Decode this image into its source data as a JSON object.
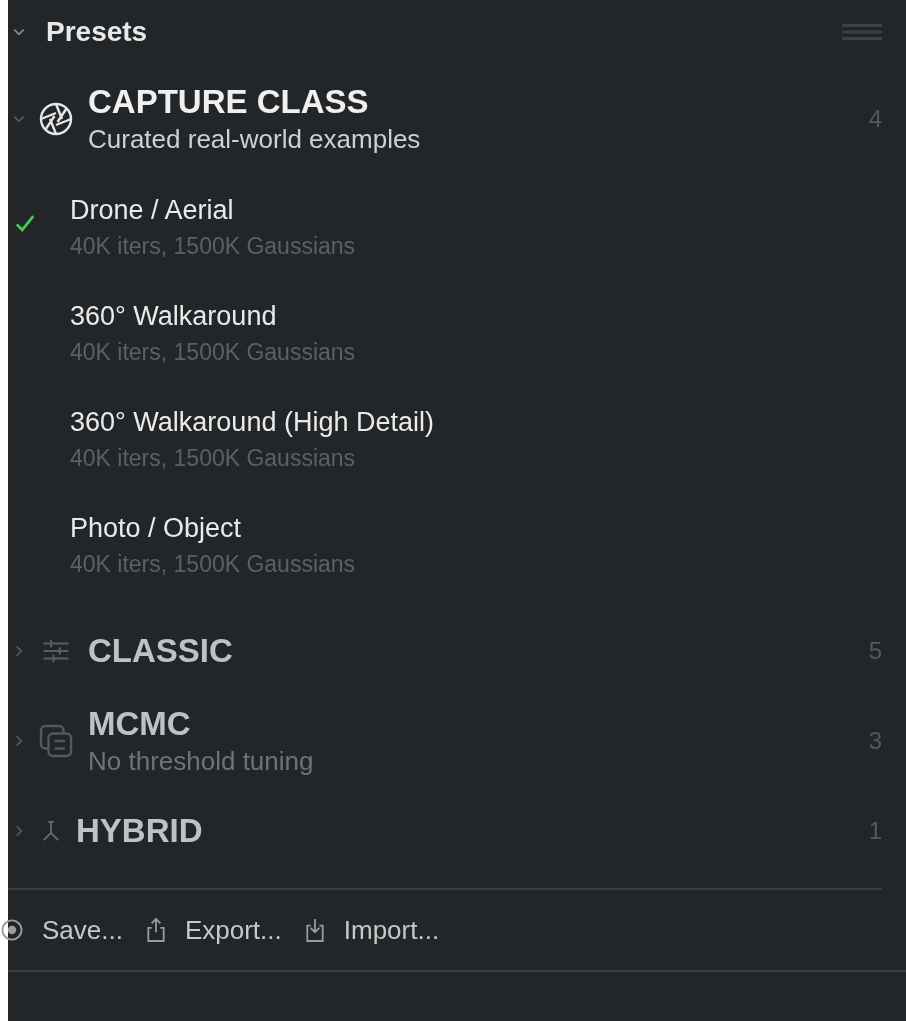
{
  "panel": {
    "title": "Presets",
    "expanded": true
  },
  "groups": [
    {
      "title": "CAPTURE CLASS",
      "subtitle": "Curated real-world examples",
      "count": "4",
      "expanded": true,
      "presets": [
        {
          "name": "Drone / Aerial",
          "detail": "40K iters, 1500K Gaussians",
          "selected": true
        },
        {
          "name": "360° Walkaround",
          "detail": "40K iters, 1500K Gaussians",
          "selected": false
        },
        {
          "name": "360° Walkaround (High Detail)",
          "detail": "40K iters, 1500K Gaussians",
          "selected": false
        },
        {
          "name": "Photo / Object",
          "detail": "40K iters, 1500K Gaussians",
          "selected": false
        }
      ]
    },
    {
      "title": "CLASSIC",
      "count": "5",
      "expanded": false
    },
    {
      "title": "MCMC",
      "subtitle": "No threshold tuning",
      "count": "3",
      "expanded": false
    },
    {
      "title": "HYBRID",
      "count": "1",
      "expanded": false
    }
  ],
  "actions": [
    "Save...",
    "Export...",
    "Import..."
  ]
}
